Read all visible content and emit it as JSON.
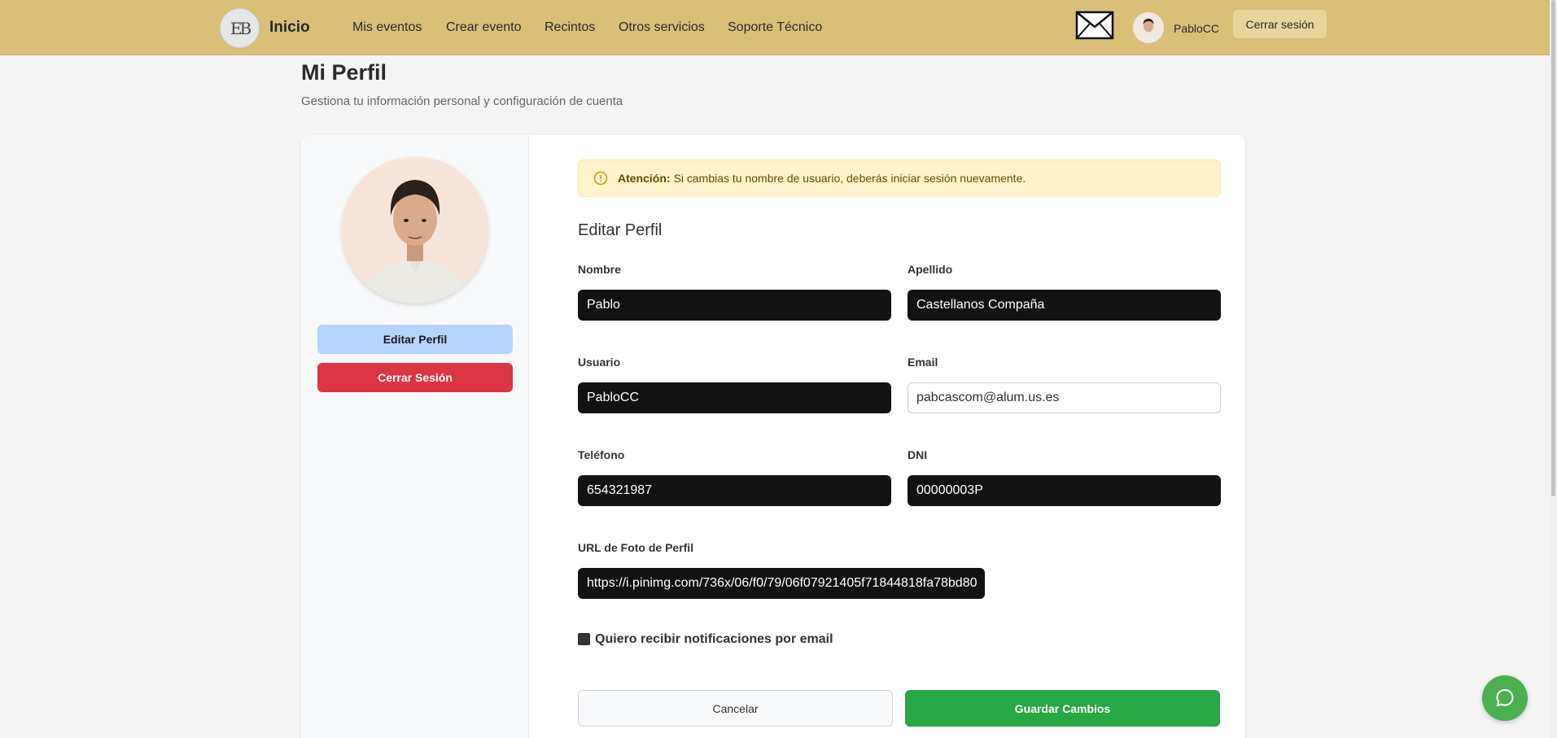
{
  "navbar": {
    "logo_text": "EB",
    "brand": "Inicio",
    "links": [
      "Mis eventos",
      "Crear evento",
      "Recintos",
      "Otros servicios",
      "Soporte Técnico"
    ],
    "username": "PabloCC",
    "logout_label": "Cerrar sesión"
  },
  "page": {
    "title": "Mi Perfil",
    "subtitle": "Gestiona tu información personal y configuración de cuenta"
  },
  "sidebar": {
    "edit_label": "Editar Perfil",
    "signout_label": "Cerrar Sesión"
  },
  "alert": {
    "strong": "Atención:",
    "text": "Si cambias tu nombre de usuario, deberás iniciar sesión nuevamente."
  },
  "form": {
    "title": "Editar Perfil",
    "nombre_label": "Nombre",
    "nombre_value": "Pablo",
    "apellido_label": "Apellido",
    "apellido_value": "Castellanos Compaña",
    "usuario_label": "Usuario",
    "usuario_value": "PabloCC",
    "email_label": "Email",
    "email_value": "pabcascom@alum.us.es",
    "telefono_label": "Teléfono",
    "telefono_value": "654321987",
    "dni_label": "DNI",
    "dni_value": "00000003P",
    "url_label": "URL de Foto de Perfil",
    "url_value": "https://i.pinimg.com/736x/06/f0/79/06f07921405f71844818fa78bd80",
    "notify_label": "Quiero recibir notificaciones por email",
    "notify_checked": false,
    "cancel_label": "Cancelar",
    "save_label": "Guardar Cambios"
  },
  "colors": {
    "navbar": "#d9bf78",
    "primary_light": "#b6d4fe",
    "danger": "#dc3545",
    "success": "#28a745",
    "warning_bg": "#fff3cd",
    "chat": "#4caf50"
  }
}
